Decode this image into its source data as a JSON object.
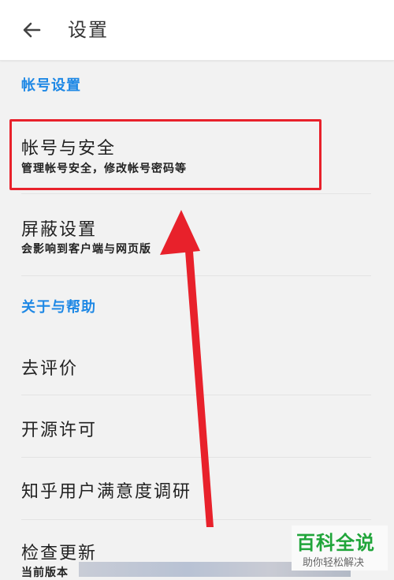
{
  "appbar": {
    "title": "设置",
    "back_icon": "arrow-left-icon"
  },
  "sections": [
    {
      "header": "帐号设置"
    },
    {
      "header": "关于与帮助"
    }
  ],
  "items": [
    {
      "title": "帐号与安全",
      "subtitle": "管理帐号安全，修改帐号密码等"
    },
    {
      "title": "屏蔽设置",
      "subtitle": "会影响到客户端与网页版"
    },
    {
      "title": "去评价"
    },
    {
      "title": "开源许可"
    },
    {
      "title": "知乎用户满意度调研"
    },
    {
      "title": "检查更新",
      "subtitle": "当前版本"
    }
  ],
  "annotation": {
    "highlight_color": "#e8212b",
    "arrow_color": "#e8212b"
  },
  "watermark": {
    "title": "百科全说",
    "subtitle": "助你轻松解决"
  },
  "colors": {
    "section_header": "#1e88e5",
    "watermark_green": "#20a53a"
  }
}
